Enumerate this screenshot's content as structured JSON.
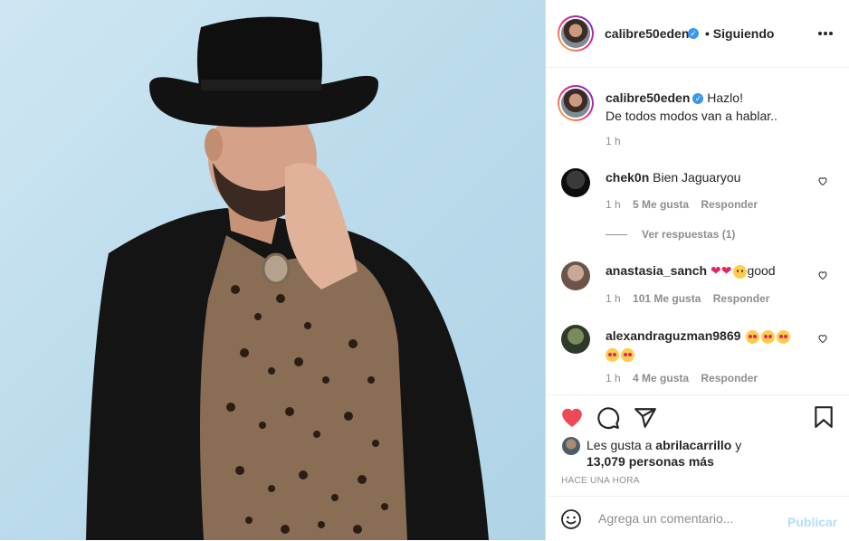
{
  "post": {
    "author": "calibre50eden",
    "follow_status": "• Siguiendo",
    "caption_line1": "Hazlo!",
    "caption_line2": "De todos modos van a hablar..",
    "caption_time": "1 h"
  },
  "comments": [
    {
      "user": "chek0n",
      "text": "Bien Jaguaryou",
      "time": "1 h",
      "likes": "5 Me gusta",
      "reply": "Responder",
      "view_replies": "Ver respuestas (1)"
    },
    {
      "user": "anastasia_sanch",
      "text": "good",
      "time": "1 h",
      "likes": "101 Me gusta",
      "reply": "Responder"
    },
    {
      "user": "alexandraguzman9869",
      "time": "1 h",
      "likes": "4 Me gusta",
      "reply": "Responder"
    }
  ],
  "likes": {
    "prefix": "Les gusta a ",
    "user": "abrilacarrillo",
    "and": " y",
    "count_text": "13,079 personas más",
    "timestamp": "HACE UNA HORA"
  },
  "add_comment": {
    "placeholder": "Agrega un comentario...",
    "post_label": "Publicar"
  },
  "icons": {
    "more": "more-options-icon",
    "like": "heart-filled-icon",
    "comment": "comment-icon",
    "share": "share-icon",
    "save": "bookmark-icon",
    "emoji": "emoji-icon"
  },
  "colors": {
    "like_red": "#ed4956",
    "verified_blue": "#3897f0",
    "publish_disabled": "#b2dffc"
  }
}
